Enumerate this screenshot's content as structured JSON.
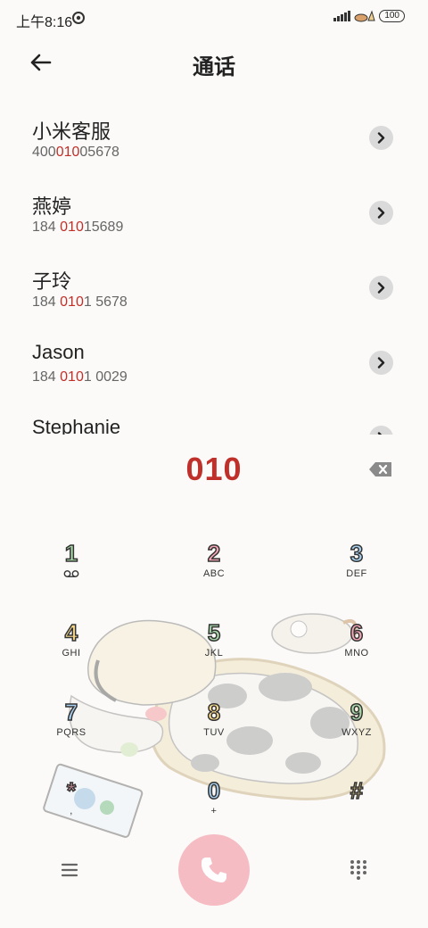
{
  "status": {
    "time": "上午8:16",
    "battery": "100"
  },
  "header": {
    "title": "通话"
  },
  "contacts": [
    {
      "name": "小米客服",
      "number_pre": "400",
      "number_hl": "010",
      "number_post": "05678"
    },
    {
      "name": "燕婷",
      "number_pre": "184 ",
      "number_hl": "010",
      "number_post": "15689"
    },
    {
      "name": "子玲",
      "number_pre": "184 ",
      "number_hl": "010",
      "number_post": "1 5678"
    },
    {
      "name": "Jason",
      "number_pre": "184 ",
      "number_hl": "010",
      "number_post": "1 0029"
    },
    {
      "name": "Stephanie",
      "number_pre": "",
      "number_hl": "",
      "number_post": ""
    }
  ],
  "dialer": {
    "dialed_number": "010"
  },
  "keypad": [
    {
      "digit": "1",
      "letters": "",
      "color": "#a8d8a8"
    },
    {
      "digit": "2",
      "letters": "ABC",
      "color": "#f4a6b4"
    },
    {
      "digit": "3",
      "letters": "DEF",
      "color": "#a8d0f0"
    },
    {
      "digit": "4",
      "letters": "GHI",
      "color": "#f7d88a"
    },
    {
      "digit": "5",
      "letters": "JKL",
      "color": "#a8d8a8"
    },
    {
      "digit": "6",
      "letters": "MNO",
      "color": "#f4a6b4"
    },
    {
      "digit": "7",
      "letters": "PQRS",
      "color": "#a8d0f0"
    },
    {
      "digit": "8",
      "letters": "TUV",
      "color": "#f7d88a"
    },
    {
      "digit": "9",
      "letters": "WXYZ",
      "color": "#a8d8a8"
    },
    {
      "digit": "*",
      "letters": ",",
      "color": "#f4a6b4"
    },
    {
      "digit": "0",
      "letters": "+",
      "color": "#a8d0f0"
    },
    {
      "digit": "#",
      "letters": "",
      "color": "#f7d88a"
    }
  ],
  "colors": {
    "accent": "#c0302a",
    "call_button": "#f6bcc3"
  },
  "icons": {
    "back": "arrow-left",
    "contact_action": "chevron-right",
    "backspace": "backspace",
    "voicemail": "voicemail",
    "menu": "hamburger-menu",
    "call": "phone",
    "dialpad": "dialpad-grid"
  }
}
